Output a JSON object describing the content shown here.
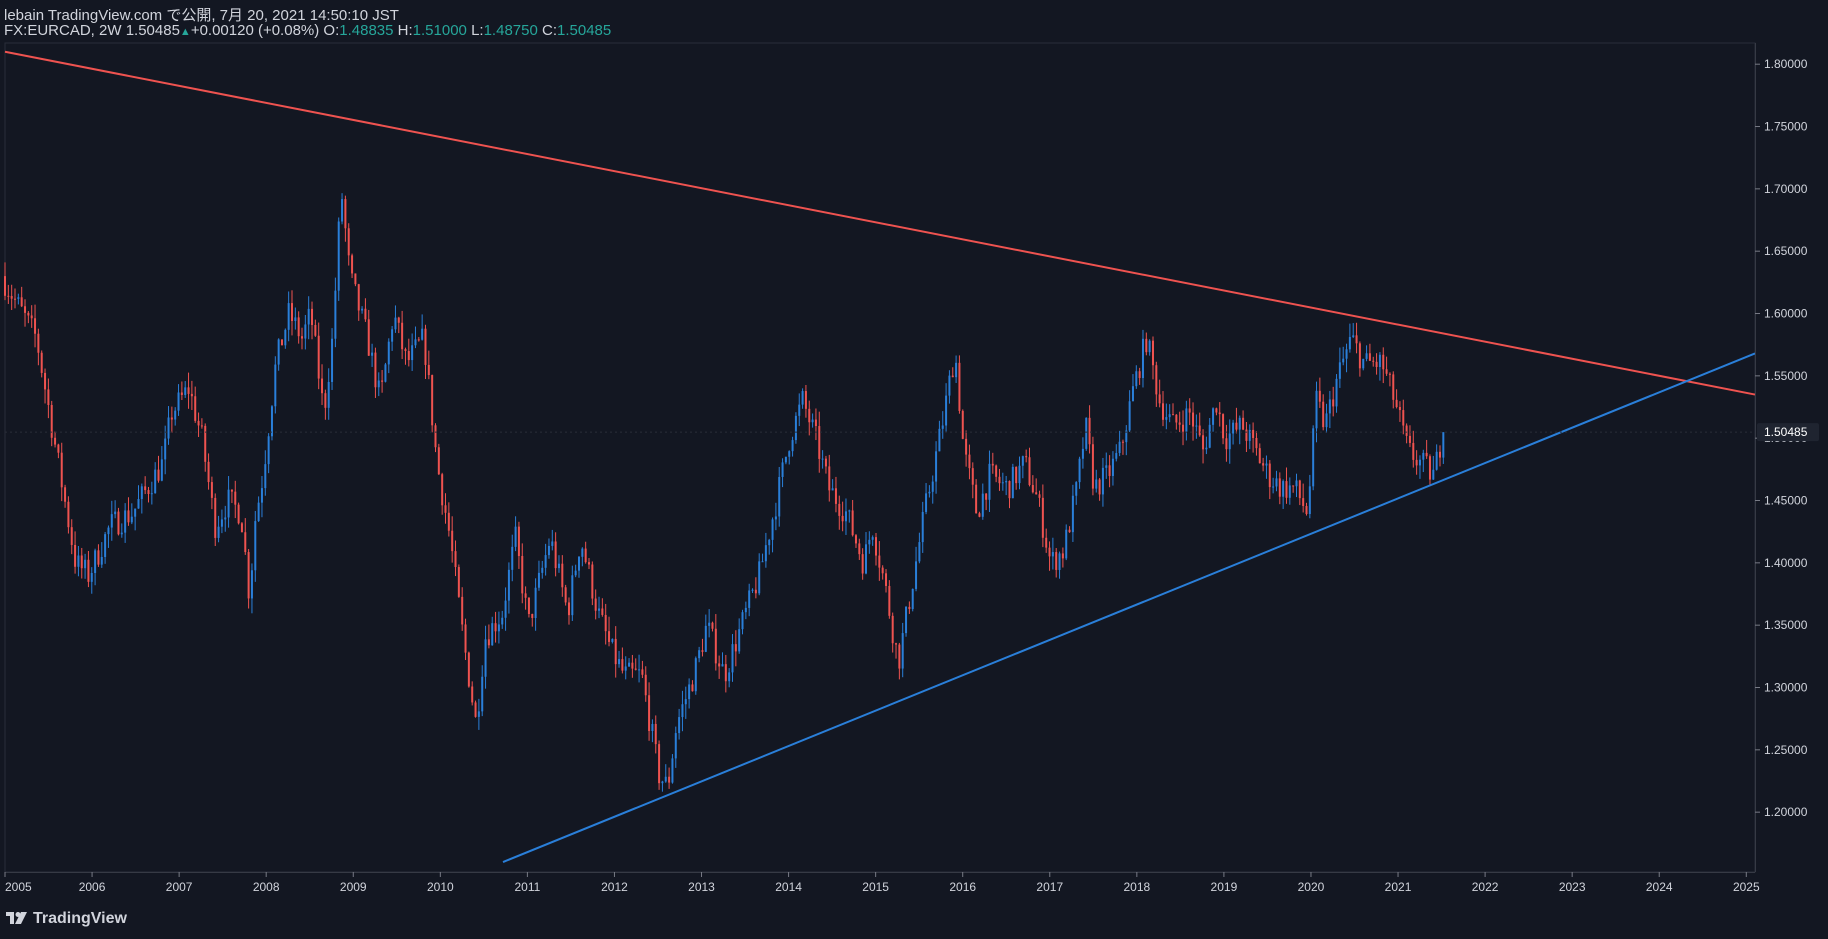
{
  "header": {
    "published": "lebain TradingView.com で公開, 7月 20, 2021 14:50:10 JST",
    "symbol": "FX:EURCAD, 2W",
    "last": "1.50485",
    "change": "+0.00120 (+0.08%)",
    "o_label": "O:",
    "o_value": "1.48835",
    "h_label": "H:",
    "h_value": "1.51000",
    "l_label": "L:",
    "l_value": "1.48750",
    "c_label": "C:",
    "c_value": "1.50485"
  },
  "footer": {
    "brand": "TradingView"
  },
  "colors": {
    "background": "#131722",
    "up": "#2a7fd9",
    "down": "#ef5350",
    "trend_resistance": "#ef5350",
    "trend_support": "#2a7fd9",
    "price_badge_bg": "#1f2430"
  },
  "chart_data": {
    "type": "candlestick",
    "symbol": "FX:EURCAD",
    "interval": "2W",
    "x_tick_labels": [
      "2005",
      "2006",
      "2007",
      "2008",
      "2009",
      "2010",
      "2011",
      "2012",
      "2013",
      "2014",
      "2015",
      "2016",
      "2017",
      "2018",
      "2019",
      "2020",
      "2021",
      "2022",
      "2023",
      "2024",
      "2025"
    ],
    "y_tick_labels": [
      "1.80000",
      "1.75000",
      "1.70000",
      "1.65000",
      "1.60000",
      "1.55000",
      "1.50000",
      "1.45000",
      "1.40000",
      "1.35000",
      "1.30000",
      "1.25000",
      "1.20000"
    ],
    "y_ticks": [
      1.8,
      1.75,
      1.7,
      1.65,
      1.6,
      1.55,
      1.5,
      1.45,
      1.4,
      1.35,
      1.3,
      1.25,
      1.2
    ],
    "ylim": [
      1.152,
      1.817
    ],
    "xlim": [
      2005.0,
      2025.1
    ],
    "last_price_label": "1.50485",
    "last_price": 1.50485,
    "anchors": [
      [
        2005.0,
        1.63
      ],
      [
        2005.4,
        1.58
      ],
      [
        2005.6,
        1.5
      ],
      [
        2005.85,
        1.4
      ],
      [
        2006.0,
        1.39
      ],
      [
        2006.25,
        1.43
      ],
      [
        2006.5,
        1.44
      ],
      [
        2006.85,
        1.48
      ],
      [
        2006.95,
        1.52
      ],
      [
        2007.15,
        1.54
      ],
      [
        2007.3,
        1.5
      ],
      [
        2007.45,
        1.43
      ],
      [
        2007.6,
        1.45
      ],
      [
        2007.75,
        1.44
      ],
      [
        2007.85,
        1.37
      ],
      [
        2007.9,
        1.43
      ],
      [
        2008.0,
        1.47
      ],
      [
        2008.15,
        1.56
      ],
      [
        2008.3,
        1.6
      ],
      [
        2008.45,
        1.58
      ],
      [
        2008.55,
        1.6
      ],
      [
        2008.7,
        1.52
      ],
      [
        2008.8,
        1.58
      ],
      [
        2008.9,
        1.7
      ],
      [
        2009.0,
        1.63
      ],
      [
        2009.2,
        1.58
      ],
      [
        2009.35,
        1.53
      ],
      [
        2009.5,
        1.6
      ],
      [
        2009.65,
        1.56
      ],
      [
        2009.85,
        1.58
      ],
      [
        2010.0,
        1.48
      ],
      [
        2010.15,
        1.42
      ],
      [
        2010.3,
        1.34
      ],
      [
        2010.45,
        1.27
      ],
      [
        2010.55,
        1.34
      ],
      [
        2010.75,
        1.36
      ],
      [
        2010.9,
        1.42
      ],
      [
        2011.05,
        1.35
      ],
      [
        2011.3,
        1.42
      ],
      [
        2011.5,
        1.36
      ],
      [
        2011.65,
        1.42
      ],
      [
        2011.85,
        1.36
      ],
      [
        2012.0,
        1.33
      ],
      [
        2012.15,
        1.31
      ],
      [
        2012.35,
        1.31
      ],
      [
        2012.55,
        1.23
      ],
      [
        2012.65,
        1.22
      ],
      [
        2012.75,
        1.27
      ],
      [
        2012.95,
        1.31
      ],
      [
        2013.1,
        1.35
      ],
      [
        2013.3,
        1.31
      ],
      [
        2013.5,
        1.35
      ],
      [
        2013.7,
        1.39
      ],
      [
        2013.9,
        1.45
      ],
      [
        2014.05,
        1.5
      ],
      [
        2014.2,
        1.53
      ],
      [
        2014.35,
        1.5
      ],
      [
        2014.5,
        1.46
      ],
      [
        2014.7,
        1.44
      ],
      [
        2014.9,
        1.4
      ],
      [
        2015.0,
        1.43
      ],
      [
        2015.15,
        1.38
      ],
      [
        2015.3,
        1.32
      ],
      [
        2015.45,
        1.38
      ],
      [
        2015.6,
        1.44
      ],
      [
        2015.8,
        1.51
      ],
      [
        2015.95,
        1.57
      ],
      [
        2016.05,
        1.49
      ],
      [
        2016.2,
        1.44
      ],
      [
        2016.35,
        1.47
      ],
      [
        2016.55,
        1.46
      ],
      [
        2016.75,
        1.48
      ],
      [
        2016.9,
        1.45
      ],
      [
        2017.05,
        1.4
      ],
      [
        2017.2,
        1.41
      ],
      [
        2017.35,
        1.46
      ],
      [
        2017.45,
        1.51
      ],
      [
        2017.55,
        1.46
      ],
      [
        2017.7,
        1.47
      ],
      [
        2017.85,
        1.49
      ],
      [
        2018.0,
        1.54
      ],
      [
        2018.15,
        1.58
      ],
      [
        2018.3,
        1.53
      ],
      [
        2018.45,
        1.51
      ],
      [
        2018.65,
        1.52
      ],
      [
        2018.8,
        1.49
      ],
      [
        2018.95,
        1.53
      ],
      [
        2019.05,
        1.5
      ],
      [
        2019.25,
        1.51
      ],
      [
        2019.4,
        1.49
      ],
      [
        2019.55,
        1.47
      ],
      [
        2019.7,
        1.46
      ],
      [
        2019.85,
        1.46
      ],
      [
        2020.0,
        1.44
      ],
      [
        2020.1,
        1.53
      ],
      [
        2020.2,
        1.51
      ],
      [
        2020.35,
        1.55
      ],
      [
        2020.5,
        1.58
      ],
      [
        2020.65,
        1.56
      ],
      [
        2020.85,
        1.56
      ],
      [
        2021.0,
        1.53
      ],
      [
        2021.15,
        1.49
      ],
      [
        2021.3,
        1.48
      ],
      [
        2021.45,
        1.47
      ],
      [
        2021.55,
        1.505
      ]
    ],
    "trendlines": [
      {
        "name": "resistance",
        "color": "#ef5350",
        "points": [
          [
            2005.0,
            1.81
          ],
          [
            2025.1,
            1.535
          ]
        ]
      },
      {
        "name": "support",
        "color": "#2a7fd9",
        "points": [
          [
            2010.72,
            1.16
          ],
          [
            2025.1,
            1.568
          ]
        ]
      }
    ]
  }
}
